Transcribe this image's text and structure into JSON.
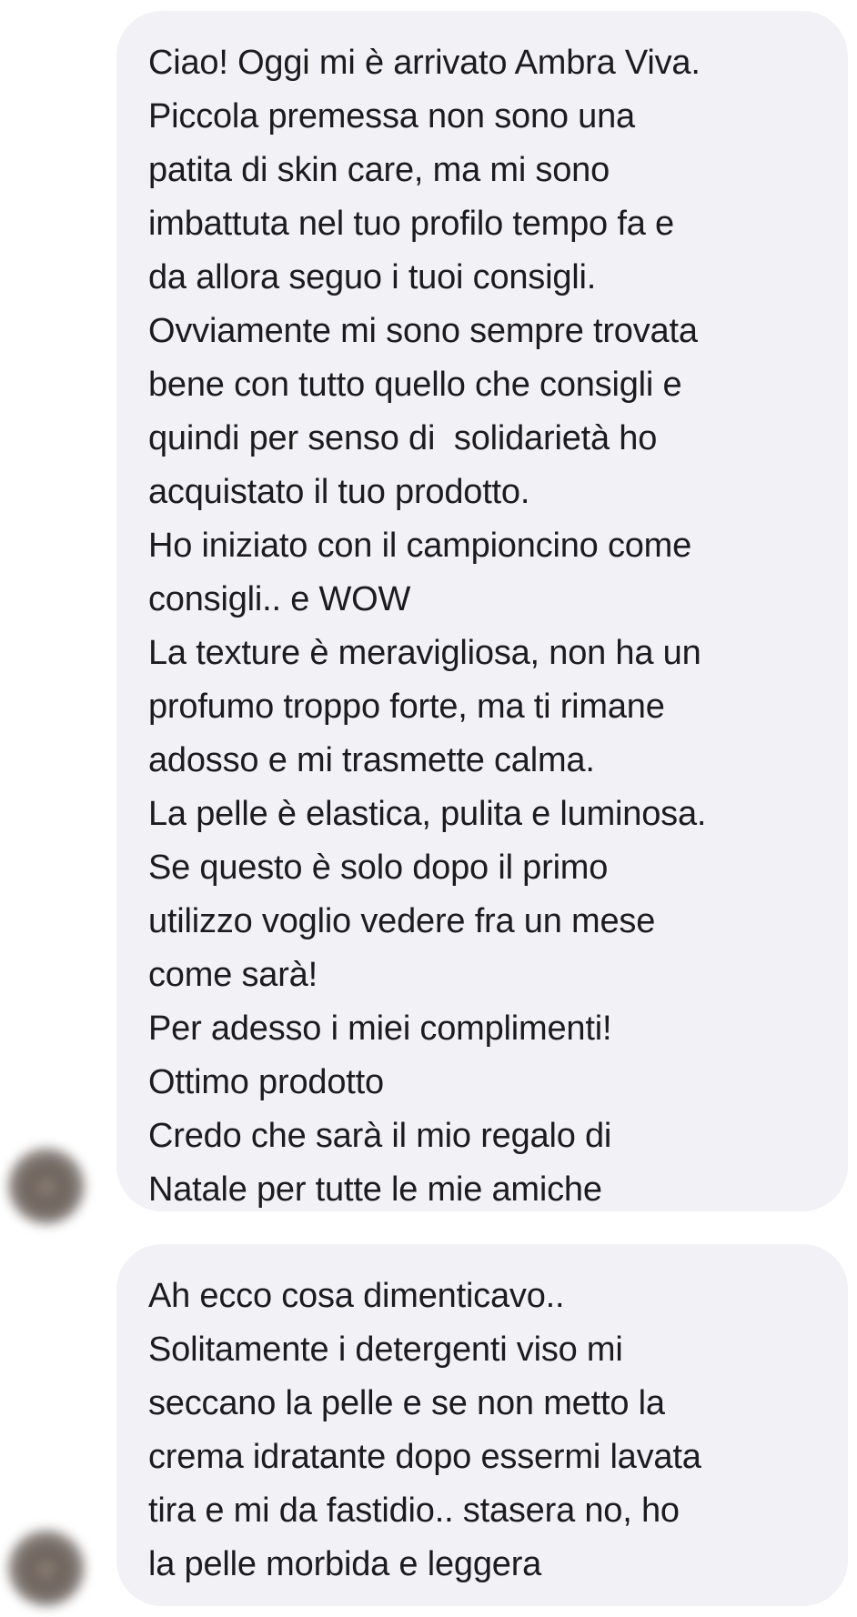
{
  "conversation": {
    "messages": [
      {
        "lines": [
          "Ciao! Oggi mi è arrivato Ambra Viva.",
          "Piccola premessa non sono una",
          "patita di skin care, ma mi sono",
          "imbattuta nel tuo profilo tempo fa e",
          "da allora seguo i tuoi consigli.",
          "Ovviamente mi sono sempre trovata",
          "bene con tutto quello che consigli e",
          "quindi per senso di  solidarietà ho",
          "acquistato il tuo prodotto.",
          "Ho iniziato con il campioncino come",
          "consigli.. e WOW",
          "La texture è meravigliosa, non ha un",
          "profumo troppo forte, ma ti rimane",
          "adosso e mi trasmette calma.",
          "La pelle è elastica, pulita e luminosa.",
          "Se questo è solo dopo il primo",
          "utilizzo voglio vedere fra un mese",
          "come sarà!",
          "Per adesso i miei complimenti!",
          "Ottimo prodotto",
          "Credo che sarà il mio regalo di",
          "Natale per tutte le mie amiche"
        ]
      },
      {
        "lines": [
          "Ah ecco cosa dimenticavo..",
          "Solitamente i detergenti viso mi",
          "seccano la pelle e se non metto la",
          "crema idratante dopo essermi lavata",
          "tira e mi da fastidio.. stasera no, ho",
          "la pelle morbida e leggera"
        ]
      }
    ]
  },
  "colors": {
    "bubble_background": "#f2f2f6",
    "text": "#1c1c1e",
    "page_background": "#ffffff"
  },
  "icons": {
    "avatar": "sender-avatar-blurred"
  }
}
